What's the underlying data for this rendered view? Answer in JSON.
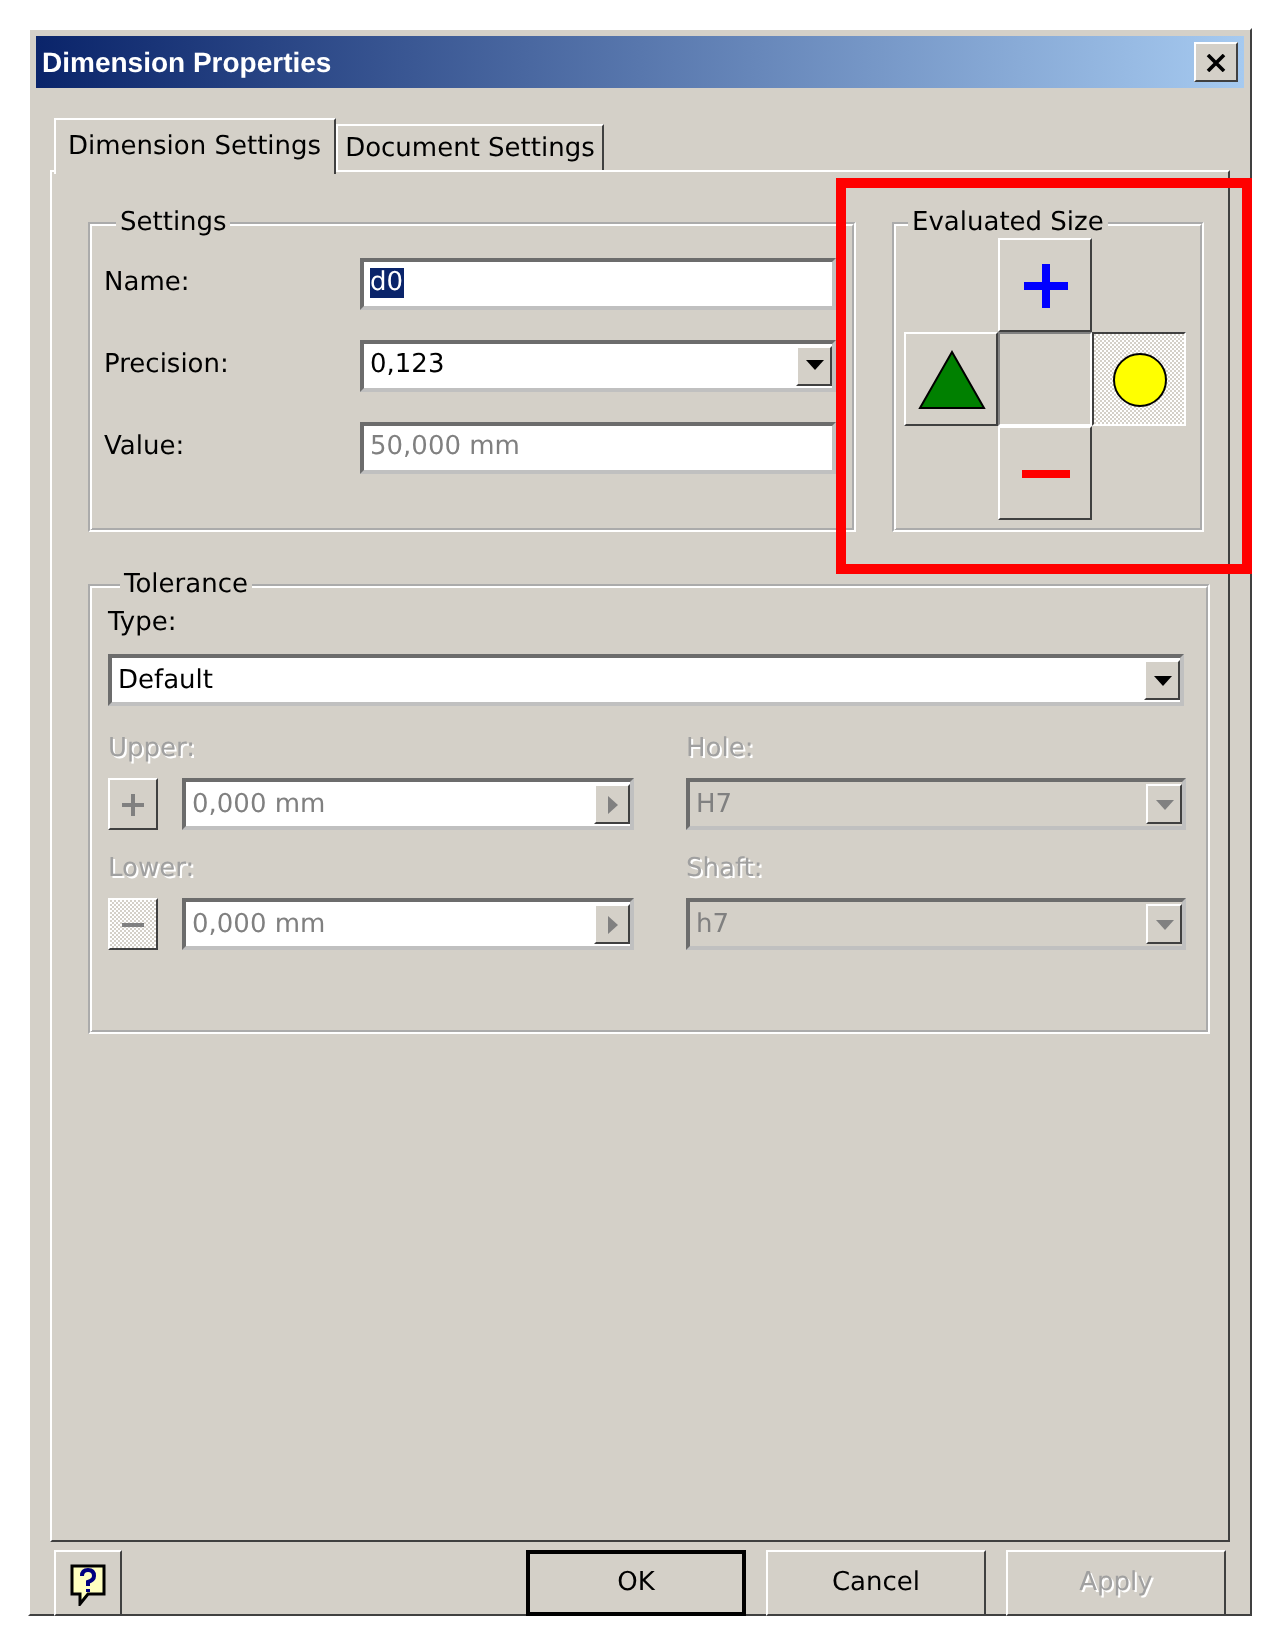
{
  "window": {
    "title": "Dimension Properties"
  },
  "tabs": [
    {
      "label": "Dimension Settings",
      "selected": true
    },
    {
      "label": "Document Settings",
      "selected": false
    }
  ],
  "settings": {
    "title": "Settings",
    "fields": [
      {
        "kind": "text",
        "label": "Name:",
        "value": "d0",
        "text_selected": true,
        "disabled": false
      },
      {
        "kind": "dropdown",
        "label": "Precision:",
        "value": "0,123",
        "text_selected": false,
        "disabled": false
      },
      {
        "kind": "text",
        "label": "Value:",
        "value": "50,000 mm",
        "text_selected": false,
        "disabled": true
      }
    ]
  },
  "evaluated_size": {
    "title": "Evaluated Size",
    "highlighted": true,
    "buttons": [
      {
        "kind": "plus",
        "selected": false
      },
      {
        "kind": "triangle",
        "selected": false
      },
      {
        "kind": "circle",
        "selected": true
      },
      {
        "kind": "minus",
        "selected": false
      }
    ]
  },
  "tolerance": {
    "title": "Tolerance",
    "type_label": "Type:",
    "type_value": "Default",
    "rows": [
      {
        "kind": "plus",
        "label": "Upper:",
        "value": "0,000 mm",
        "fit_label": "Hole:",
        "fit_value": "H7",
        "disabled": true
      },
      {
        "kind": "minus",
        "label": "Lower:",
        "value": "0,000 mm",
        "fit_label": "Shaft:",
        "fit_value": "h7",
        "disabled": true
      }
    ]
  },
  "buttons": [
    {
      "label": "OK",
      "default": true,
      "disabled": false
    },
    {
      "label": "Cancel",
      "default": false,
      "disabled": false
    },
    {
      "label": "Apply",
      "default": false,
      "disabled": true
    }
  ]
}
